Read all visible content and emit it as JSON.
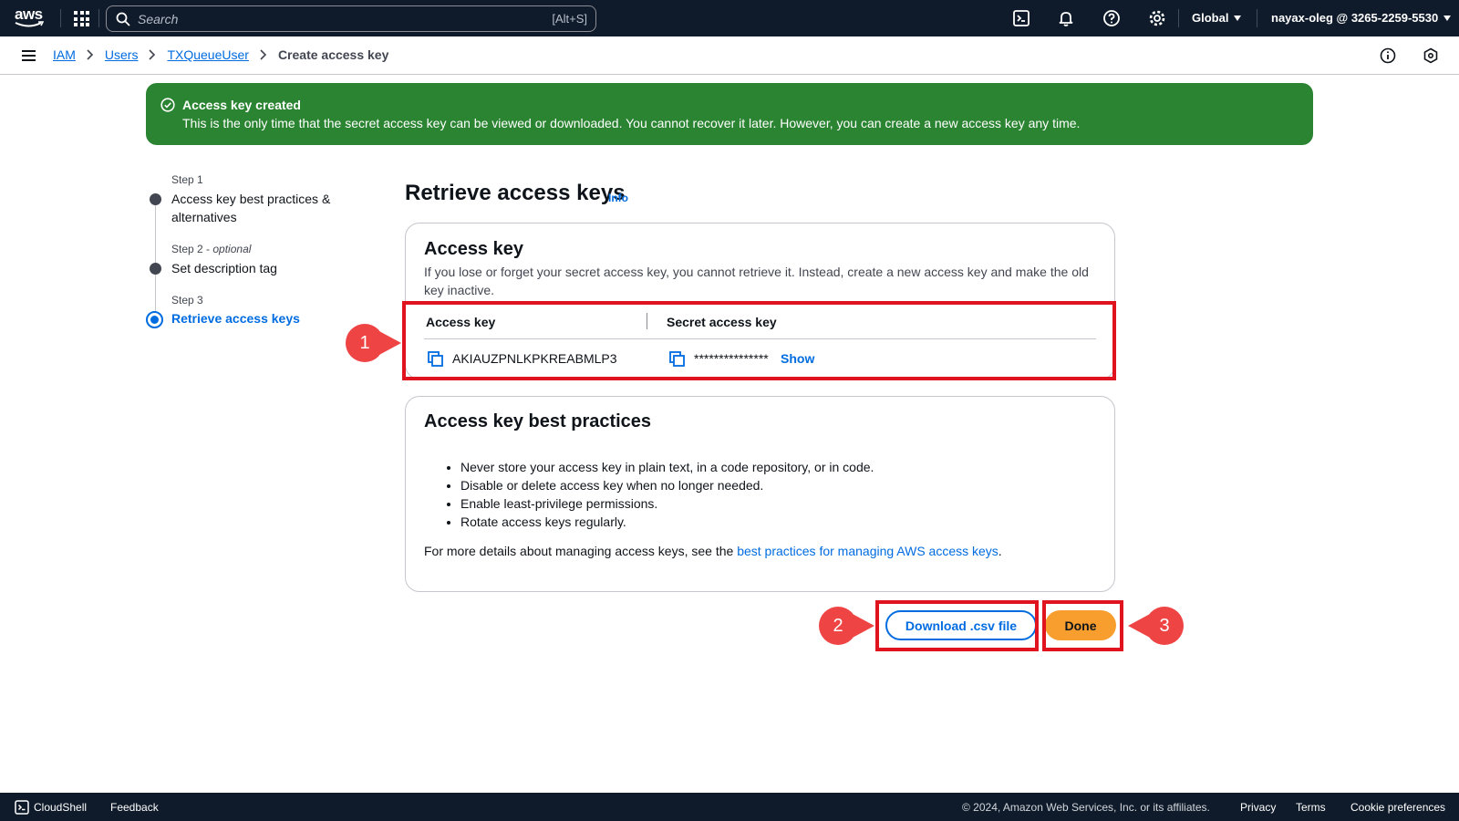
{
  "topnav": {
    "logo_text": "aws",
    "search_placeholder": "Search",
    "search_hint": "[Alt+S]",
    "region": "Global",
    "account": "nayax-oleg @ 3265-2259-5530"
  },
  "breadcrumb": {
    "items": [
      "IAM",
      "Users",
      "TXQueueUser"
    ],
    "current": "Create access key"
  },
  "flash": {
    "title": "Access key created",
    "body": "This is the only time that the secret access key can be viewed or downloaded. You cannot recover it later. However, you can create a new access key any time."
  },
  "steps": [
    {
      "label": "Step 1",
      "optional": "",
      "text": "Access key best practices &",
      "text2": "alternatives"
    },
    {
      "label": "Step 2",
      "optional": "optional",
      "text": "Set description tag"
    },
    {
      "label": "Step 3",
      "optional": "",
      "text": "Retrieve access keys"
    }
  ],
  "main": {
    "title": "Retrieve access keys",
    "info": "Info"
  },
  "access_key_card": {
    "heading": "Access key",
    "description": "If you lose or forget your secret access key, you cannot retrieve it. Instead, create a new access key and make the old key inactive.",
    "col_access_key": "Access key",
    "col_secret_key": "Secret access key",
    "access_key_value": "AKIAUZPNLKPKREABMLP3",
    "secret_masked": "***************",
    "show": "Show"
  },
  "best_practices_card": {
    "heading": "Access key best practices",
    "items": [
      "Never store your access key in plain text, in a code repository, or in code.",
      "Disable or delete access key when no longer needed.",
      "Enable least-privilege permissions.",
      "Rotate access keys regularly."
    ],
    "more_prefix": "For more details about managing access keys, see the ",
    "more_link": "best practices for managing AWS access keys",
    "more_suffix": "."
  },
  "buttons": {
    "download": "Download .csv file",
    "done": "Done"
  },
  "annotations": {
    "m1": "1",
    "m2": "2",
    "m3": "3",
    "color": "#e0141e",
    "marker_color": "#ef4444"
  },
  "footer": {
    "cloudshell": "CloudShell",
    "feedback": "Feedback",
    "copyright": "© 2024, Amazon Web Services, Inc. or its affiliates.",
    "privacy": "Privacy",
    "terms": "Terms",
    "cookie": "Cookie preferences"
  }
}
